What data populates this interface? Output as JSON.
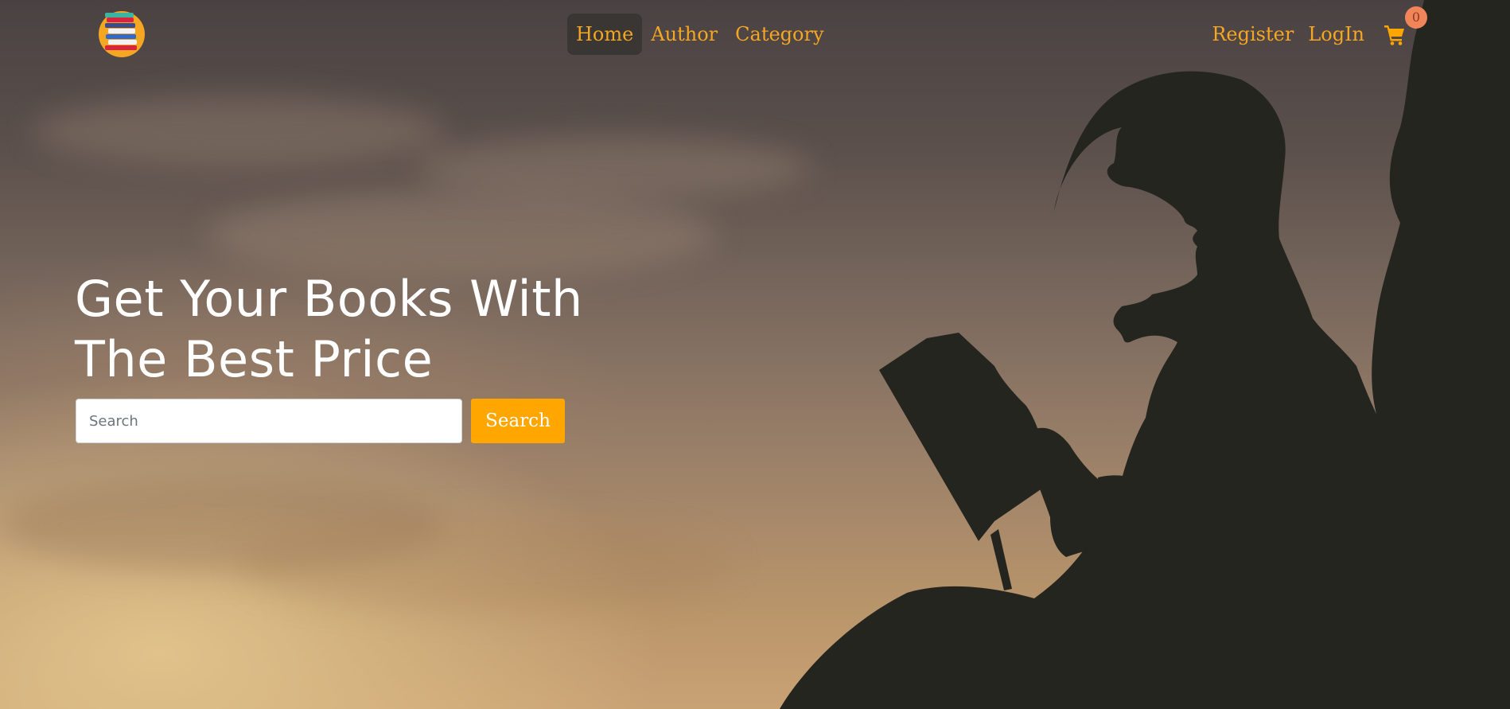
{
  "nav": {
    "links": [
      "Home",
      "Author",
      "Category"
    ],
    "register": "Register",
    "login": "LogIn",
    "cart_count": "0"
  },
  "hero": {
    "headline_line1": "Get Your Books With",
    "headline_line2": "The Best Price",
    "search_placeholder": "Search",
    "search_button": "Search"
  },
  "colors": {
    "accent": "#ffa600",
    "badge": "#f0855a",
    "active_nav_bg": "#3a3633"
  },
  "icons": [
    "logo-books-icon",
    "cart-icon"
  ]
}
